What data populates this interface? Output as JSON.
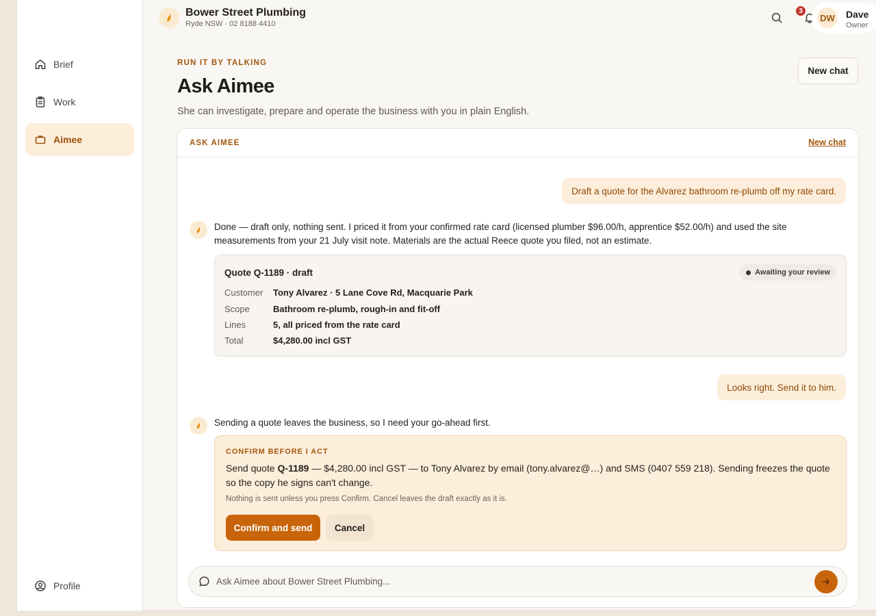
{
  "sidebar": {
    "items": [
      {
        "label": "Brief",
        "icon": "home-icon"
      },
      {
        "label": "Work",
        "icon": "clipboard-icon"
      },
      {
        "label": "Aimee",
        "icon": "briefcase-icon"
      }
    ],
    "profile_label": "Profile"
  },
  "header": {
    "business_name": "Bower Street Plumbing",
    "business_sub": "Ryde NSW · 02 8188 4410",
    "notification_count": "3",
    "user": {
      "initials": "DW",
      "name": "Dave",
      "role": "Owner"
    }
  },
  "page": {
    "eyebrow": "RUN IT BY TALKING",
    "title": "Ask Aimee",
    "subtitle": "She can investigate, prepare and operate the business with you in plain English.",
    "new_chat_label": "New chat"
  },
  "chat": {
    "panel_label": "ASK AIMEE",
    "panel_new_chat": "New chat",
    "messages": [
      {
        "role": "user",
        "text": "Draft a quote for the Alvarez bathroom re-plumb off my rate card."
      },
      {
        "role": "assistant",
        "text": "Done — draft only, nothing sent. I priced it from your confirmed rate card (licensed plumber $96.00/h, apprentice $52.00/h) and used the site measurements from your 21 July visit note. Materials are the actual Reece quote you filed, not an estimate."
      },
      {
        "role": "user",
        "text": "Looks right. Send it to him."
      },
      {
        "role": "assistant",
        "text": "Sending a quote leaves the business, so I need your go-ahead first."
      }
    ],
    "quote": {
      "title": "Quote Q-1189 · draft",
      "status": "Awaiting your review",
      "rows": [
        {
          "key": "Customer",
          "value": "Tony Alvarez · 5 Lane Cove Rd, Macquarie Park"
        },
        {
          "key": "Scope",
          "value": "Bathroom re-plumb, rough-in and fit-off"
        },
        {
          "key": "Lines",
          "value": "5, all priced from the rate card"
        },
        {
          "key": "Total",
          "value": "$4,280.00 incl GST"
        }
      ]
    },
    "confirm": {
      "label": "CONFIRM BEFORE I ACT",
      "text_prefix": "Send quote ",
      "quote_ref": "Q-1189",
      "text_suffix": " — $4,280.00 incl GST — to Tony Alvarez by email (tony.alvarez@…) and SMS (0407 559 218). Sending freezes the quote so the copy he signs can't change.",
      "note": "Nothing is sent unless you press Confirm. Cancel leaves the draft exactly as it is.",
      "confirm_label": "Confirm and send",
      "cancel_label": "Cancel"
    },
    "composer_placeholder": "Ask Aimee about Bower Street Plumbing..."
  },
  "colors": {
    "accent": "#c8650b",
    "accent_text": "#a3560c",
    "accent_soft": "#fdeedb",
    "badge": "#c0362c"
  }
}
